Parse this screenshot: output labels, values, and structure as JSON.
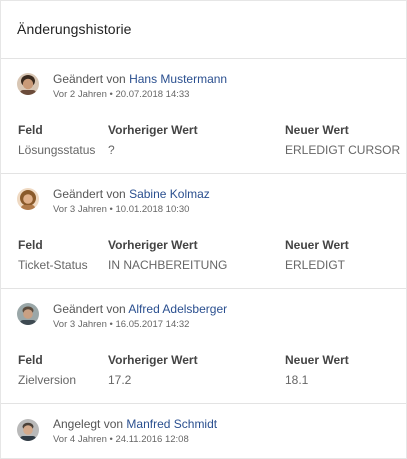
{
  "title": "Änderungshistorie",
  "entries": [
    {
      "action": "Geändert von",
      "author": "Hans Mustermann",
      "relative": "Vor 2 Jahren",
      "timestamp": "20.07.2018 14:33",
      "avatar_hair": "#3a2a1e",
      "avatar_skin": "#c99a78",
      "avatar_bg": "#d8c6b4",
      "headers": [
        "Feld",
        "Vorheriger Wert",
        "Neuer Wert"
      ],
      "field": "Lösungsstatus",
      "old": "?",
      "new": "ERLEDIGT CURSOR"
    },
    {
      "action": "Geändert von",
      "author": "Sabine Kolmaz",
      "relative": "Vor 3 Jahren",
      "timestamp": "10.01.2018 10:30",
      "avatar_hair": "#8a5a2b",
      "avatar_skin": "#e0b08a",
      "avatar_bg": "#efd9c2",
      "headers": [
        "Feld",
        "Vorheriger Wert",
        "Neuer Wert"
      ],
      "field": "Ticket-Status",
      "old": "IN NACHBEREITUNG",
      "new": "ERLEDIGT"
    },
    {
      "action": "Geändert von",
      "author": "Alfred Adelsberger",
      "relative": "Vor 3 Jahren",
      "timestamp": "16.05.2017 14:32",
      "avatar_hair": "#5a4a3c",
      "avatar_skin": "#c9a083",
      "avatar_bg": "#9aa7a8",
      "headers": [
        "Feld",
        "Vorheriger Wert",
        "Neuer Wert"
      ],
      "field": "Zielversion",
      "old": "17.2",
      "new": "18.1"
    },
    {
      "action": "Angelegt von",
      "author": "Manfred Schmidt",
      "relative": "Vor 4 Jahren",
      "timestamp": "24.11.2016 12:08",
      "avatar_hair": "#4a4038",
      "avatar_skin": "#d4aa8c",
      "avatar_bg": "#b9b9b9"
    }
  ],
  "colors": {
    "link": "#2a4f8f",
    "divider": "#e3e3e3"
  },
  "meta_separator": "•"
}
